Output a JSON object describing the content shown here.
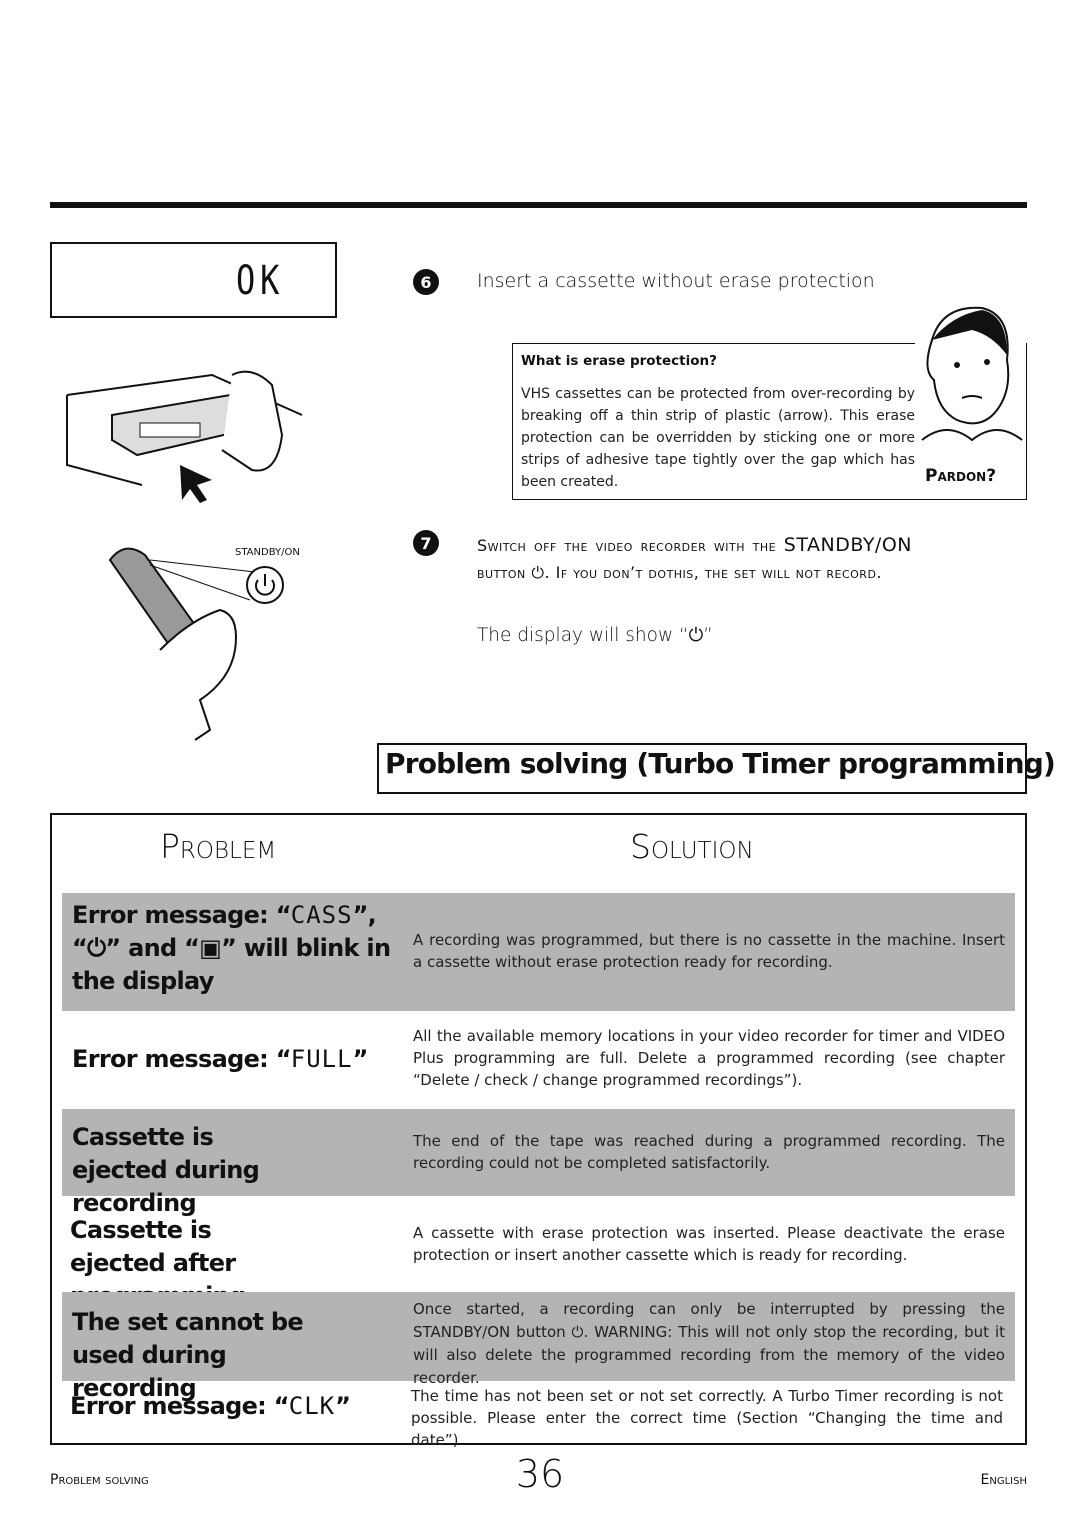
{
  "display_top": {
    "text": "OK"
  },
  "step6": {
    "number": "6",
    "text": "Insert a cassette without erase protection"
  },
  "note": {
    "title": "What is erase protection?",
    "body": "VHS cassettes can be protected from over-recording by breaking off a thin strip of plastic (arrow). This erase protection can be overridden by sticking one or more strips of adhesive tape tightly over the gap which has been created.",
    "pardon": "Pardon?"
  },
  "remote": {
    "label": "STANDBY/ON"
  },
  "step7": {
    "number": "7",
    "pre": "Switch off the video recorder with the ",
    "bold": "STANDBY/ON",
    "post": " button ⏻. If you don’t dothis, the set will not record.",
    "display_line": "The display will show “⏻”"
  },
  "section_title": "Problem solving (Turbo Timer programming)",
  "table": {
    "header_problem": "Problem",
    "header_solution": "Solution",
    "rows": [
      {
        "problem_a": "Error message: “",
        "problem_seg": "CASS",
        "problem_b": "”, “⏻” and “▣” will blink in the display",
        "solution": "A recording was programmed, but there is no cassette in the machine. Insert a cassette without erase protection ready for recording."
      },
      {
        "problem_a": "Error message: “",
        "problem_seg": "FULL",
        "problem_b": "”",
        "solution": "All the available memory locations in your video recorder for timer and VIDEO Plus programming are full. Delete a programmed recording (see chapter “Delete / check / change programmed recordings”)."
      },
      {
        "problem": "Cassette is ejected during recording",
        "solution": "The end of the tape was reached during a programmed recording. The recording could not be completed satisfactorily."
      },
      {
        "problem": "Cassette is ejected after programming",
        "solution": "A cassette with erase protection was inserted. Please deactivate the erase protection or insert another cassette which is ready for recording."
      },
      {
        "problem": "The set cannot be used during recording",
        "solution": "Once started, a recording can only be interrupted by pressing the STANDBY/ON button ⏻. WARNING: This will not only stop the recording, but it will also delete the programmed recording from the memory of the video recorder."
      },
      {
        "problem_a": "Error message: “",
        "problem_seg": "CLK",
        "problem_b": "”",
        "solution": "The time has not been set or not set correctly. A Turbo Timer recording is not possible. Please enter the correct time (Section “Changing the time and date”)"
      }
    ]
  },
  "footer": {
    "left": "Problem solving",
    "page": "36",
    "right": "English"
  },
  "colors": {
    "row_gray": "#b4b4b4",
    "ink": "#111111"
  }
}
